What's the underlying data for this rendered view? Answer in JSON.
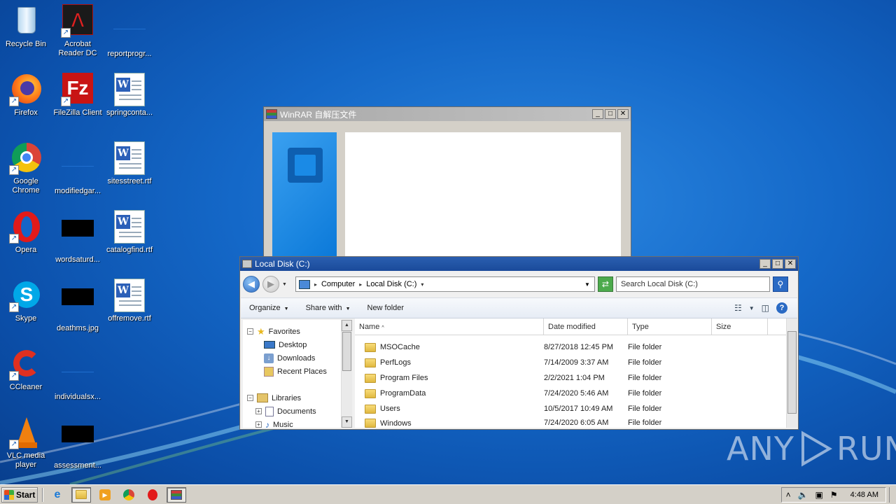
{
  "desktop": {
    "icons": [
      {
        "label": "Recycle Bin"
      },
      {
        "label": "Acrobat Reader DC"
      },
      {
        "label": "reportprogr..."
      },
      {
        "label": "Firefox"
      },
      {
        "label": "FileZilla Client"
      },
      {
        "label": "springconta..."
      },
      {
        "label": "Google Chrome"
      },
      {
        "label": "modifiedgar..."
      },
      {
        "label": "sitesstreet.rtf"
      },
      {
        "label": "Opera"
      },
      {
        "label": "wordsaturd..."
      },
      {
        "label": "catalogfind.rtf"
      },
      {
        "label": "Skype"
      },
      {
        "label": "deathms.jpg"
      },
      {
        "label": "offremove.rtf"
      },
      {
        "label": "CCleaner"
      },
      {
        "label": "individualsx..."
      },
      {
        "label": "VLC media player"
      },
      {
        "label": "assessment..."
      }
    ]
  },
  "winrar": {
    "title": "WinRAR 自解压文件"
  },
  "explorer": {
    "title": "Local Disk (C:)",
    "breadcrumb": [
      "Computer",
      "Local Disk (C:)"
    ],
    "search_placeholder": "Search Local Disk (C:)",
    "commands": {
      "organize": "Organize",
      "share": "Share with",
      "new_folder": "New folder"
    },
    "nav": {
      "favorites": "Favorites",
      "desktop": "Desktop",
      "downloads": "Downloads",
      "recent": "Recent Places",
      "libraries": "Libraries",
      "documents": "Documents",
      "music": "Music"
    },
    "columns": {
      "name": "Name",
      "date": "Date modified",
      "type": "Type",
      "size": "Size"
    },
    "files": [
      {
        "name": "MSOCache",
        "date": "8/27/2018 12:45 PM",
        "type": "File folder"
      },
      {
        "name": "PerfLogs",
        "date": "7/14/2009 3:37 AM",
        "type": "File folder"
      },
      {
        "name": "Program Files",
        "date": "2/2/2021 1:04 PM",
        "type": "File folder"
      },
      {
        "name": "ProgramData",
        "date": "7/24/2020 5:46 AM",
        "type": "File folder"
      },
      {
        "name": "Users",
        "date": "10/5/2017 10:49 AM",
        "type": "File folder"
      },
      {
        "name": "Windows",
        "date": "7/24/2020 6:05 AM",
        "type": "File folder"
      }
    ]
  },
  "taskbar": {
    "start_label": "Start",
    "clock": "4:48 AM"
  },
  "watermark": {
    "left": "ANY",
    "right": "RUN"
  }
}
